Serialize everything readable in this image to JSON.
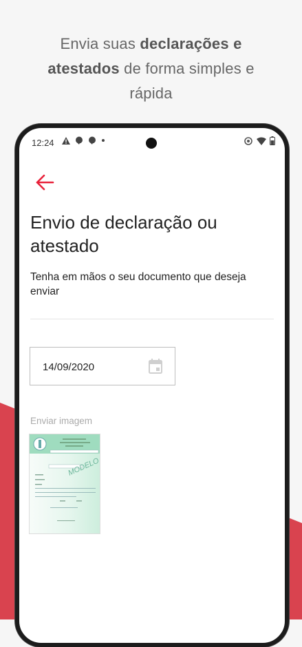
{
  "promo": {
    "line1_normal": "Envia suas ",
    "line1_bold": "declarações e",
    "line2_bold": "atestados",
    "line2_normal": " de forma simples e",
    "line3_normal": "rápida"
  },
  "status_bar": {
    "time": "12:24",
    "left_icons": [
      "warning-icon",
      "chat-bubble-icon",
      "chat-bubble-icon",
      "dot-icon"
    ],
    "right_icons": [
      "vibrate-icon",
      "wifi-icon",
      "battery-icon"
    ]
  },
  "screen": {
    "back_icon": "arrow-left-icon",
    "title": "Envio de declaração ou atestado",
    "subtitle": "Tenha em mãos o seu documento que deseja enviar",
    "date_value": "14/09/2020",
    "date_icon": "calendar-icon",
    "image_label": "Enviar imagem",
    "thumbnail_watermark": "MODELO"
  },
  "colors": {
    "accent": "#e8213a",
    "promo_red": "#d9434f",
    "page_bg": "#f6f6f6"
  }
}
